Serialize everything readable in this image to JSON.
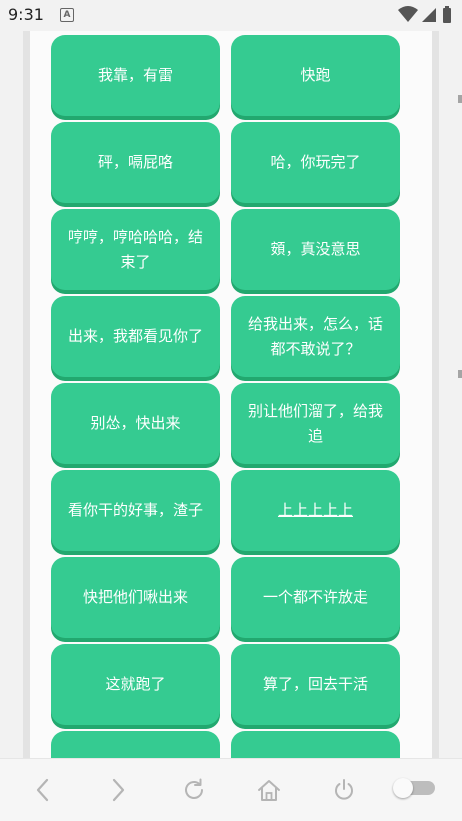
{
  "status_bar": {
    "time": "9:31",
    "app_badge": "A"
  },
  "buttons": [
    {
      "label": "我靠，有雷"
    },
    {
      "label": "快跑"
    },
    {
      "label": "砰，嗝屁咯"
    },
    {
      "label": "哈，你玩完了"
    },
    {
      "label": "哼哼，哼哈哈哈，结束了"
    },
    {
      "label": "頞，真没意思"
    },
    {
      "label": "出来，我都看见你了"
    },
    {
      "label": "给我出来，怎么，话都不敢说了？"
    },
    {
      "label": "别怂，快出来"
    },
    {
      "label": "别让他们溜了，给我追"
    },
    {
      "label": "看你干的好事，渣子"
    },
    {
      "label": "上上上上上"
    },
    {
      "label": "快把他们啾出来"
    },
    {
      "label": "一个都不许放走"
    },
    {
      "label": "这就跑了"
    },
    {
      "label": "算了，回去干活"
    },
    {
      "label": ""
    },
    {
      "label": ""
    }
  ],
  "colors": {
    "tile": "#35cb91",
    "tile_shadow": "#22a86f",
    "icon": "#b5b5b5"
  },
  "nav": {
    "icons": [
      "back-icon",
      "forward-icon",
      "refresh-icon",
      "home-icon",
      "power-icon",
      "toggle-switch"
    ]
  }
}
